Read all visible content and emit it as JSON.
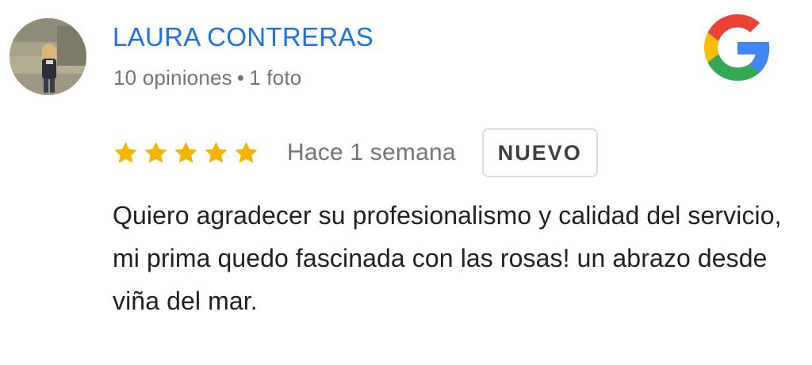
{
  "review": {
    "author_name": "LAURA CONTRERAS",
    "author_reviews": "10 opiniones",
    "separator": "•",
    "author_photos": "1 foto",
    "rating": 5,
    "rating_max": 5,
    "time": "Hace 1 semana",
    "badge": "NUEVO",
    "text": "Quiero agradecer su profesionalismo y calidad del servicio, mi prima quedo fascinada con las rosas! un abrazo desde viña del mar."
  },
  "icons": {
    "avatar": "user-photo",
    "source": "google-icon",
    "star": "star-icon"
  },
  "colors": {
    "author_name": "#1a73e8",
    "star": "#f4b400",
    "meta": "#70757a",
    "text": "#202124",
    "badge_border": "#dadce0"
  }
}
